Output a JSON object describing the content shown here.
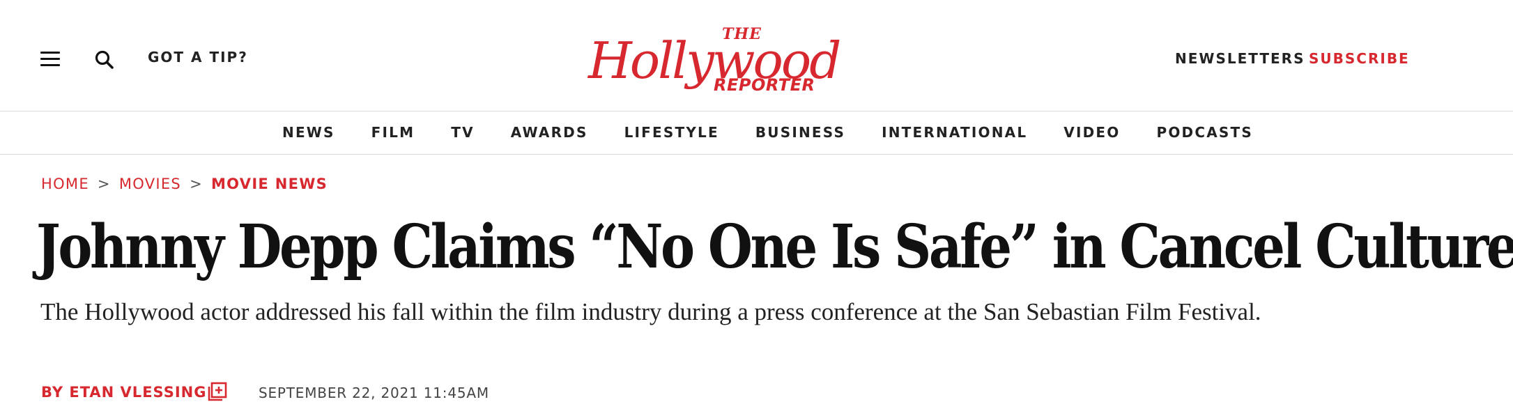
{
  "header": {
    "tip_label": "GOT A TIP?",
    "newsletters_label": "NEWSLETTERS",
    "subscribe_label": "SUBSCRIBE",
    "brand_color": "#d7282f"
  },
  "logo": {
    "top": "THE",
    "main": "Hollywood",
    "bottom": "REPORTER"
  },
  "nav": {
    "items": [
      "NEWS",
      "FILM",
      "TV",
      "AWARDS",
      "LIFESTYLE",
      "BUSINESS",
      "INTERNATIONAL",
      "VIDEO",
      "PODCASTS"
    ]
  },
  "breadcrumb": {
    "home": "HOME",
    "movies": "MOVIES",
    "current": "MOVIE NEWS",
    "separator": ">"
  },
  "article": {
    "headline": "Johnny Depp Claims “No One Is Safe” in Cancel Culture",
    "dek": "The Hollywood actor addressed his fall within the film industry during a press conference at the San Sebastian Film Festival.",
    "byline": "BY ETAN VLESSING",
    "date": "SEPTEMBER 22, 2021 11:45AM"
  },
  "icons": {
    "menu": "menu-icon",
    "search": "search-icon",
    "author_add": "author-plus-icon"
  }
}
